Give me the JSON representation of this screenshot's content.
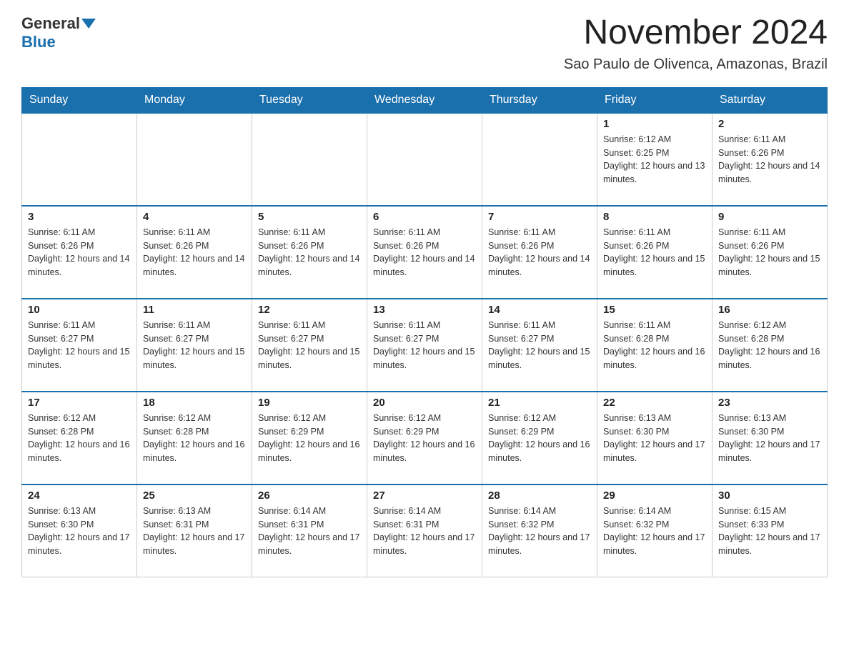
{
  "header": {
    "logo_general": "General",
    "logo_blue": "Blue",
    "month_title": "November 2024",
    "location": "Sao Paulo de Olivenca, Amazonas, Brazil"
  },
  "days_of_week": [
    "Sunday",
    "Monday",
    "Tuesday",
    "Wednesday",
    "Thursday",
    "Friday",
    "Saturday"
  ],
  "weeks": [
    [
      {
        "day": "",
        "info": ""
      },
      {
        "day": "",
        "info": ""
      },
      {
        "day": "",
        "info": ""
      },
      {
        "day": "",
        "info": ""
      },
      {
        "day": "",
        "info": ""
      },
      {
        "day": "1",
        "info": "Sunrise: 6:12 AM\nSunset: 6:25 PM\nDaylight: 12 hours and 13 minutes."
      },
      {
        "day": "2",
        "info": "Sunrise: 6:11 AM\nSunset: 6:26 PM\nDaylight: 12 hours and 14 minutes."
      }
    ],
    [
      {
        "day": "3",
        "info": "Sunrise: 6:11 AM\nSunset: 6:26 PM\nDaylight: 12 hours and 14 minutes."
      },
      {
        "day": "4",
        "info": "Sunrise: 6:11 AM\nSunset: 6:26 PM\nDaylight: 12 hours and 14 minutes."
      },
      {
        "day": "5",
        "info": "Sunrise: 6:11 AM\nSunset: 6:26 PM\nDaylight: 12 hours and 14 minutes."
      },
      {
        "day": "6",
        "info": "Sunrise: 6:11 AM\nSunset: 6:26 PM\nDaylight: 12 hours and 14 minutes."
      },
      {
        "day": "7",
        "info": "Sunrise: 6:11 AM\nSunset: 6:26 PM\nDaylight: 12 hours and 14 minutes."
      },
      {
        "day": "8",
        "info": "Sunrise: 6:11 AM\nSunset: 6:26 PM\nDaylight: 12 hours and 15 minutes."
      },
      {
        "day": "9",
        "info": "Sunrise: 6:11 AM\nSunset: 6:26 PM\nDaylight: 12 hours and 15 minutes."
      }
    ],
    [
      {
        "day": "10",
        "info": "Sunrise: 6:11 AM\nSunset: 6:27 PM\nDaylight: 12 hours and 15 minutes."
      },
      {
        "day": "11",
        "info": "Sunrise: 6:11 AM\nSunset: 6:27 PM\nDaylight: 12 hours and 15 minutes."
      },
      {
        "day": "12",
        "info": "Sunrise: 6:11 AM\nSunset: 6:27 PM\nDaylight: 12 hours and 15 minutes."
      },
      {
        "day": "13",
        "info": "Sunrise: 6:11 AM\nSunset: 6:27 PM\nDaylight: 12 hours and 15 minutes."
      },
      {
        "day": "14",
        "info": "Sunrise: 6:11 AM\nSunset: 6:27 PM\nDaylight: 12 hours and 15 minutes."
      },
      {
        "day": "15",
        "info": "Sunrise: 6:11 AM\nSunset: 6:28 PM\nDaylight: 12 hours and 16 minutes."
      },
      {
        "day": "16",
        "info": "Sunrise: 6:12 AM\nSunset: 6:28 PM\nDaylight: 12 hours and 16 minutes."
      }
    ],
    [
      {
        "day": "17",
        "info": "Sunrise: 6:12 AM\nSunset: 6:28 PM\nDaylight: 12 hours and 16 minutes."
      },
      {
        "day": "18",
        "info": "Sunrise: 6:12 AM\nSunset: 6:28 PM\nDaylight: 12 hours and 16 minutes."
      },
      {
        "day": "19",
        "info": "Sunrise: 6:12 AM\nSunset: 6:29 PM\nDaylight: 12 hours and 16 minutes."
      },
      {
        "day": "20",
        "info": "Sunrise: 6:12 AM\nSunset: 6:29 PM\nDaylight: 12 hours and 16 minutes."
      },
      {
        "day": "21",
        "info": "Sunrise: 6:12 AM\nSunset: 6:29 PM\nDaylight: 12 hours and 16 minutes."
      },
      {
        "day": "22",
        "info": "Sunrise: 6:13 AM\nSunset: 6:30 PM\nDaylight: 12 hours and 17 minutes."
      },
      {
        "day": "23",
        "info": "Sunrise: 6:13 AM\nSunset: 6:30 PM\nDaylight: 12 hours and 17 minutes."
      }
    ],
    [
      {
        "day": "24",
        "info": "Sunrise: 6:13 AM\nSunset: 6:30 PM\nDaylight: 12 hours and 17 minutes."
      },
      {
        "day": "25",
        "info": "Sunrise: 6:13 AM\nSunset: 6:31 PM\nDaylight: 12 hours and 17 minutes."
      },
      {
        "day": "26",
        "info": "Sunrise: 6:14 AM\nSunset: 6:31 PM\nDaylight: 12 hours and 17 minutes."
      },
      {
        "day": "27",
        "info": "Sunrise: 6:14 AM\nSunset: 6:31 PM\nDaylight: 12 hours and 17 minutes."
      },
      {
        "day": "28",
        "info": "Sunrise: 6:14 AM\nSunset: 6:32 PM\nDaylight: 12 hours and 17 minutes."
      },
      {
        "day": "29",
        "info": "Sunrise: 6:14 AM\nSunset: 6:32 PM\nDaylight: 12 hours and 17 minutes."
      },
      {
        "day": "30",
        "info": "Sunrise: 6:15 AM\nSunset: 6:33 PM\nDaylight: 12 hours and 17 minutes."
      }
    ]
  ]
}
